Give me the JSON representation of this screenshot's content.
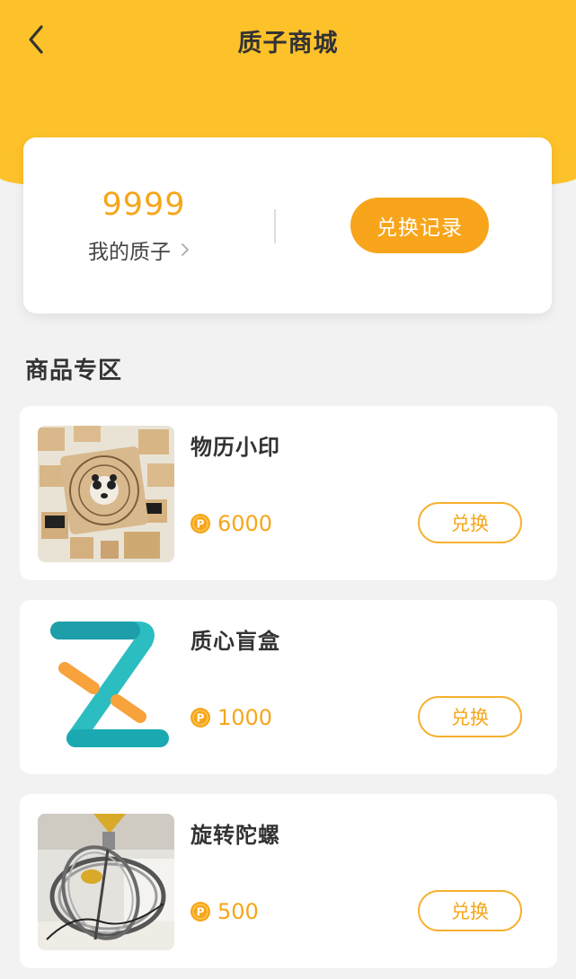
{
  "header": {
    "title": "质子商城",
    "back_icon": "chevron-left-icon"
  },
  "balance": {
    "value": "9999",
    "label": "我的质子",
    "records_button": "兑换记录"
  },
  "section": {
    "title": "商品专区"
  },
  "products": [
    {
      "name": "物历小印",
      "price": "6000",
      "button": "兑换",
      "image": "stamp-set-image"
    },
    {
      "name": "质心盲盒",
      "price": "1000",
      "button": "兑换",
      "image": "z-logo-image"
    },
    {
      "name": "旋转陀螺",
      "price": "500",
      "button": "兑换",
      "image": "gyroscope-image"
    }
  ],
  "colors": {
    "brand_yellow": "#fdc22a",
    "accent_orange": "#f6a61a",
    "background": "#f2f2f2"
  },
  "coin_letter": "P"
}
